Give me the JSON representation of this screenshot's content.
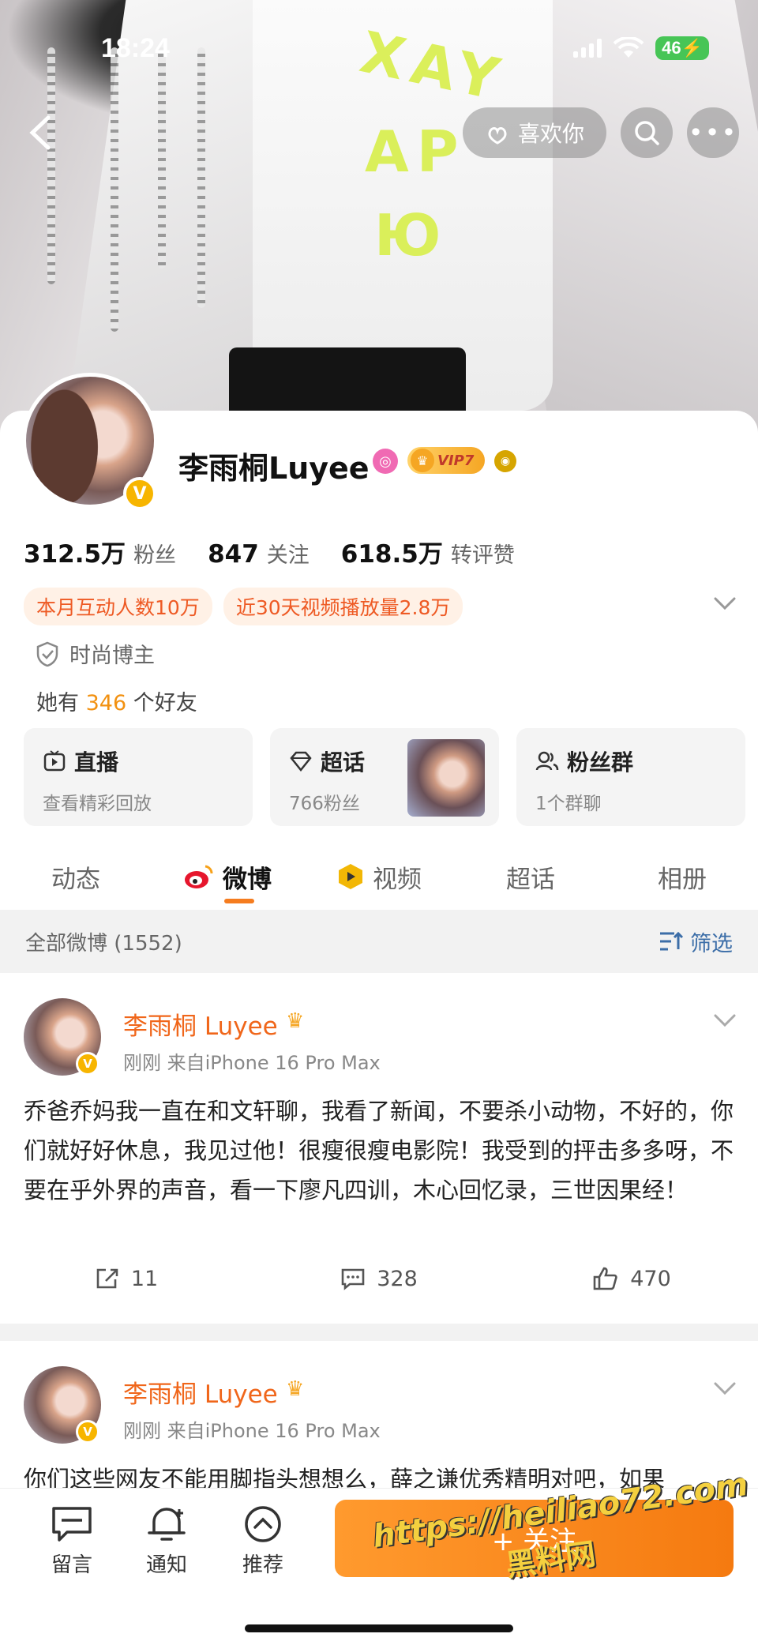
{
  "status_bar": {
    "time": "18:24",
    "battery": "46"
  },
  "header": {
    "like_label": "喜欢你"
  },
  "cover_text": {
    "line1": "XAY",
    "line2": "AP",
    "line3": "Ю"
  },
  "profile": {
    "name": "李雨桐Luyee",
    "vip": "VIP7",
    "stats": [
      {
        "num": "312.5万",
        "label": "粉丝"
      },
      {
        "num": "847",
        "label": "关注"
      },
      {
        "num": "618.5万",
        "label": "转评赞"
      }
    ],
    "tags": [
      "本月互动人数10万",
      "近30天视频播放量2.8万"
    ],
    "category": "时尚博主",
    "friends_prefix": "她有",
    "friends_count": "346",
    "friends_suffix": "个好友"
  },
  "boxes": [
    {
      "title": "直播",
      "sub": "查看精彩回放"
    },
    {
      "title": "超话",
      "sub": "766粉丝"
    },
    {
      "title": "粉丝群",
      "sub": "1个群聊"
    }
  ],
  "tabs": [
    "动态",
    "微博",
    "视频",
    "超话",
    "相册"
  ],
  "feed": {
    "title": "全部微博 (1552)",
    "filter": "筛选"
  },
  "posts": [
    {
      "name": "李雨桐 Luyee",
      "meta": "刚刚  来自iPhone 16 Pro Max",
      "text": "乔爸乔妈我一直在和文轩聊，我看了新闻，不要杀小动物，不好的，你们就好好休息，我见过他！很瘦很瘦电影院！我受到的抨击多多呀，不要在乎外界的声音，看一下廖凡四训，木心回忆录，三世因果经！",
      "reposts": "11",
      "comments": "328",
      "likes": "470"
    },
    {
      "name": "李雨桐 Luyee",
      "meta": "刚刚  来自iPhone 16 Pro Max",
      "text": "你们这些网友不能用脚指头想想么，薛之谦优秀精明对吧，如果"
    }
  ],
  "bottom_nav": [
    {
      "label": "留言",
      "icon": "message-icon"
    },
    {
      "label": "通知",
      "icon": "bell-icon"
    },
    {
      "label": "推荐",
      "icon": "recommend-icon"
    }
  ],
  "follow_label": "+ 关注",
  "watermark": {
    "url": "https://heiliao72.com",
    "name": "黑料网"
  },
  "colors": {
    "accent": "#f57c1f",
    "name_orange": "#f0661a",
    "link_blue": "#3c6ea8",
    "verified": "#f7b500"
  }
}
